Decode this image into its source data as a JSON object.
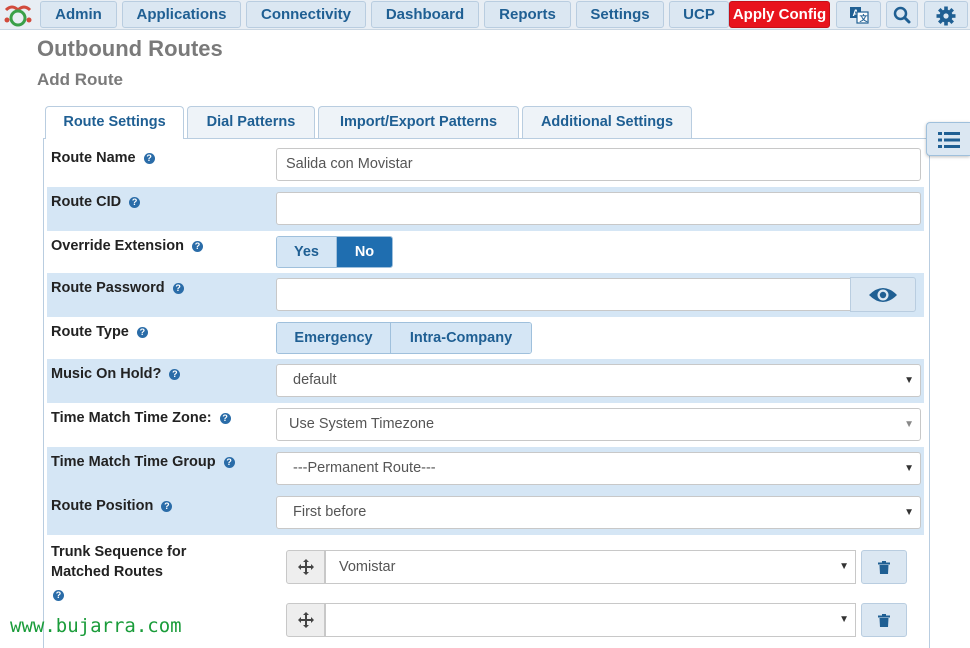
{
  "nav": {
    "items": [
      "Admin",
      "Applications",
      "Connectivity",
      "Dashboard",
      "Reports",
      "Settings",
      "UCP"
    ],
    "apply_label": "Apply Config"
  },
  "page": {
    "title": "Outbound Routes",
    "subtitle": "Add Route"
  },
  "tabs": [
    "Route Settings",
    "Dial Patterns",
    "Import/Export Patterns",
    "Additional Settings"
  ],
  "form": {
    "route_name": {
      "label": "Route Name",
      "value": "Salida con Movistar"
    },
    "route_cid": {
      "label": "Route CID",
      "value": ""
    },
    "override_extension": {
      "label": "Override Extension",
      "options": [
        "Yes",
        "No"
      ],
      "selected": "No"
    },
    "route_password": {
      "label": "Route Password",
      "value": ""
    },
    "route_type": {
      "label": "Route Type",
      "options": [
        "Emergency",
        "Intra-Company"
      ]
    },
    "music_on_hold": {
      "label": "Music On Hold?",
      "value": "default"
    },
    "time_zone": {
      "label": "Time Match Time Zone:",
      "value": "Use System Timezone"
    },
    "time_group": {
      "label": "Time Match Time Group",
      "value": "---Permanent Route---"
    },
    "route_position": {
      "label": "Route Position",
      "value": "First before"
    },
    "trunk_sequence": {
      "label_line1": "Trunk Sequence for",
      "label_line2": "Matched Routes",
      "trunks": [
        "Vomistar",
        ""
      ]
    }
  },
  "watermark": "www.bujarra.com",
  "colors": {
    "accent": "#1f6eb0",
    "apply": "#e8131d",
    "row_alt": "#d5e6f5",
    "watermark": "#1a9c3a"
  }
}
